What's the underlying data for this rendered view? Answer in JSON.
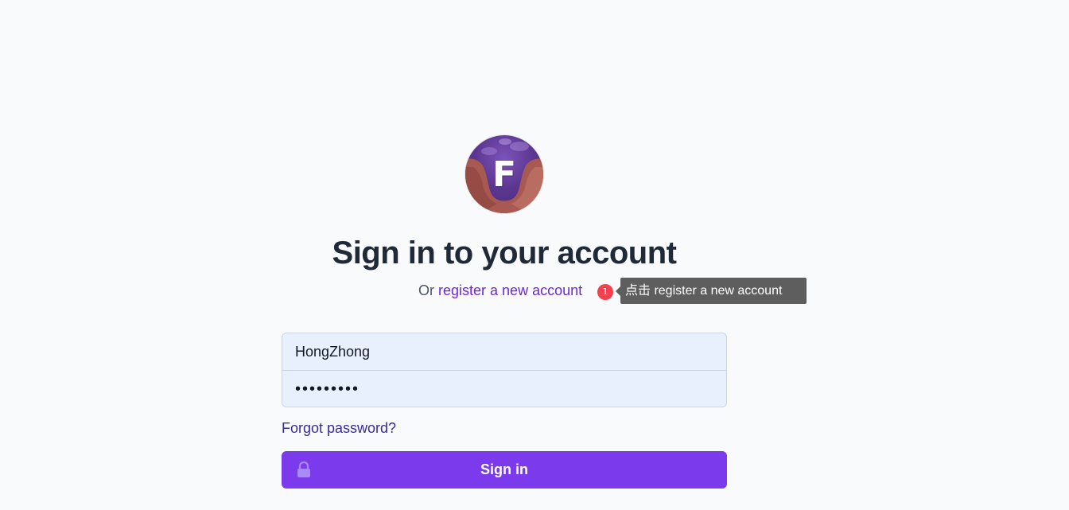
{
  "header": {
    "logo_letter": "F",
    "title": "Sign in to your account",
    "subtitle_prefix": "Or",
    "register_link": "register a new account"
  },
  "hint": {
    "badge_number": "1",
    "tooltip_text": "点击 register a new account"
  },
  "form": {
    "username_value": "HongZhong",
    "password_value": "•••••••••",
    "forgot_label": "Forgot password?",
    "signin_label": "Sign in"
  },
  "colors": {
    "background": "#f9fafb",
    "accent": "#7c3aed",
    "link": "#6d28d9",
    "input_bg": "#e8f0fe",
    "badge": "#f43f4f",
    "tooltip_bg": "#5e5e5e"
  },
  "icons": {
    "lock": "lock-icon"
  }
}
